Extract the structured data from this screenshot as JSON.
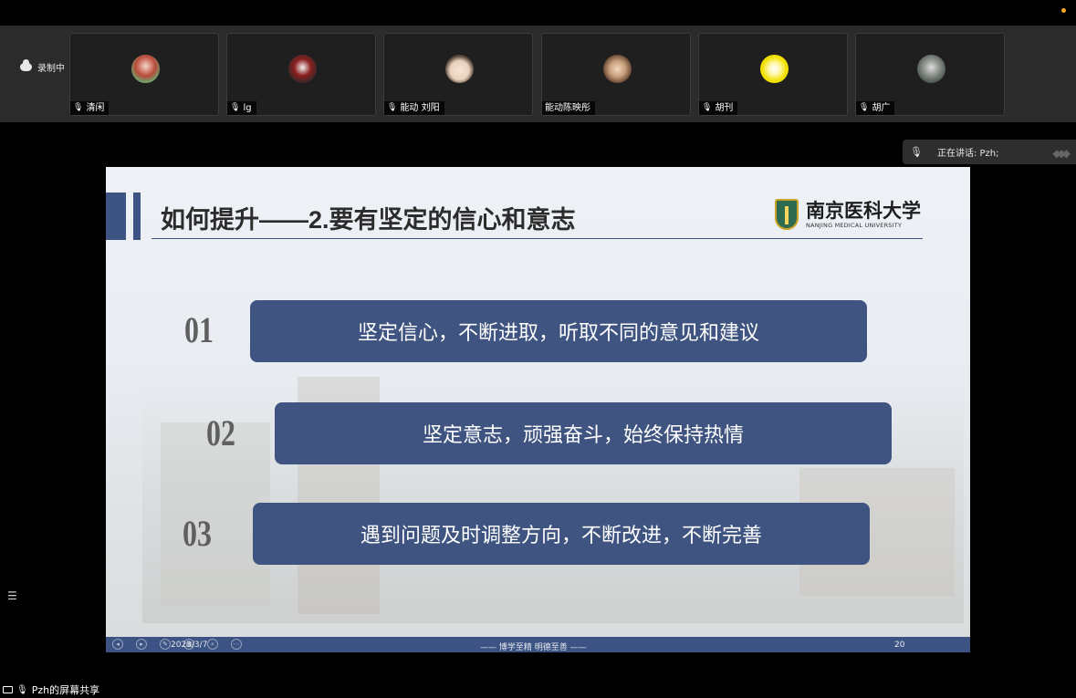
{
  "recording": {
    "label": "录制中"
  },
  "participants": [
    {
      "name": "清闲",
      "muted": true,
      "avatar_color": "#c9d7b3"
    },
    {
      "name": "lg",
      "muted": true,
      "avatar_color": "#5a4a4a"
    },
    {
      "name": "能动 刘阳",
      "muted": true,
      "avatar_color": "#e7d7c8"
    },
    {
      "name": "能动陈映彤",
      "muted": false,
      "avatar_color": "#c8a98a"
    },
    {
      "name": "胡刊",
      "muted": true,
      "avatar_color": "#f2e100"
    },
    {
      "name": "胡广",
      "muted": true,
      "avatar_color": "#7b8780"
    }
  ],
  "speaking": {
    "label": "正在讲话: Pzh;"
  },
  "slide": {
    "title": "如何提升——2.要有坚定的信心和意志",
    "logo": {
      "cn": "南京医科大学",
      "en": "NANJING MEDICAL UNIVERSITY"
    },
    "items": [
      {
        "num": "01",
        "text": "坚定信心，不断进取，听取不同的意见和建议"
      },
      {
        "num": "02",
        "text": "坚定意志，顽强奋斗，始终保持热情"
      },
      {
        "num": "03",
        "text": "遇到问题及时调整方向，不断改进，不断完善"
      }
    ],
    "footer": {
      "date": "2023/3/7",
      "motto": "——  博学至精  明德至善  ——",
      "page": "20"
    }
  },
  "share": {
    "label": "Pzh的屏幕共享"
  }
}
